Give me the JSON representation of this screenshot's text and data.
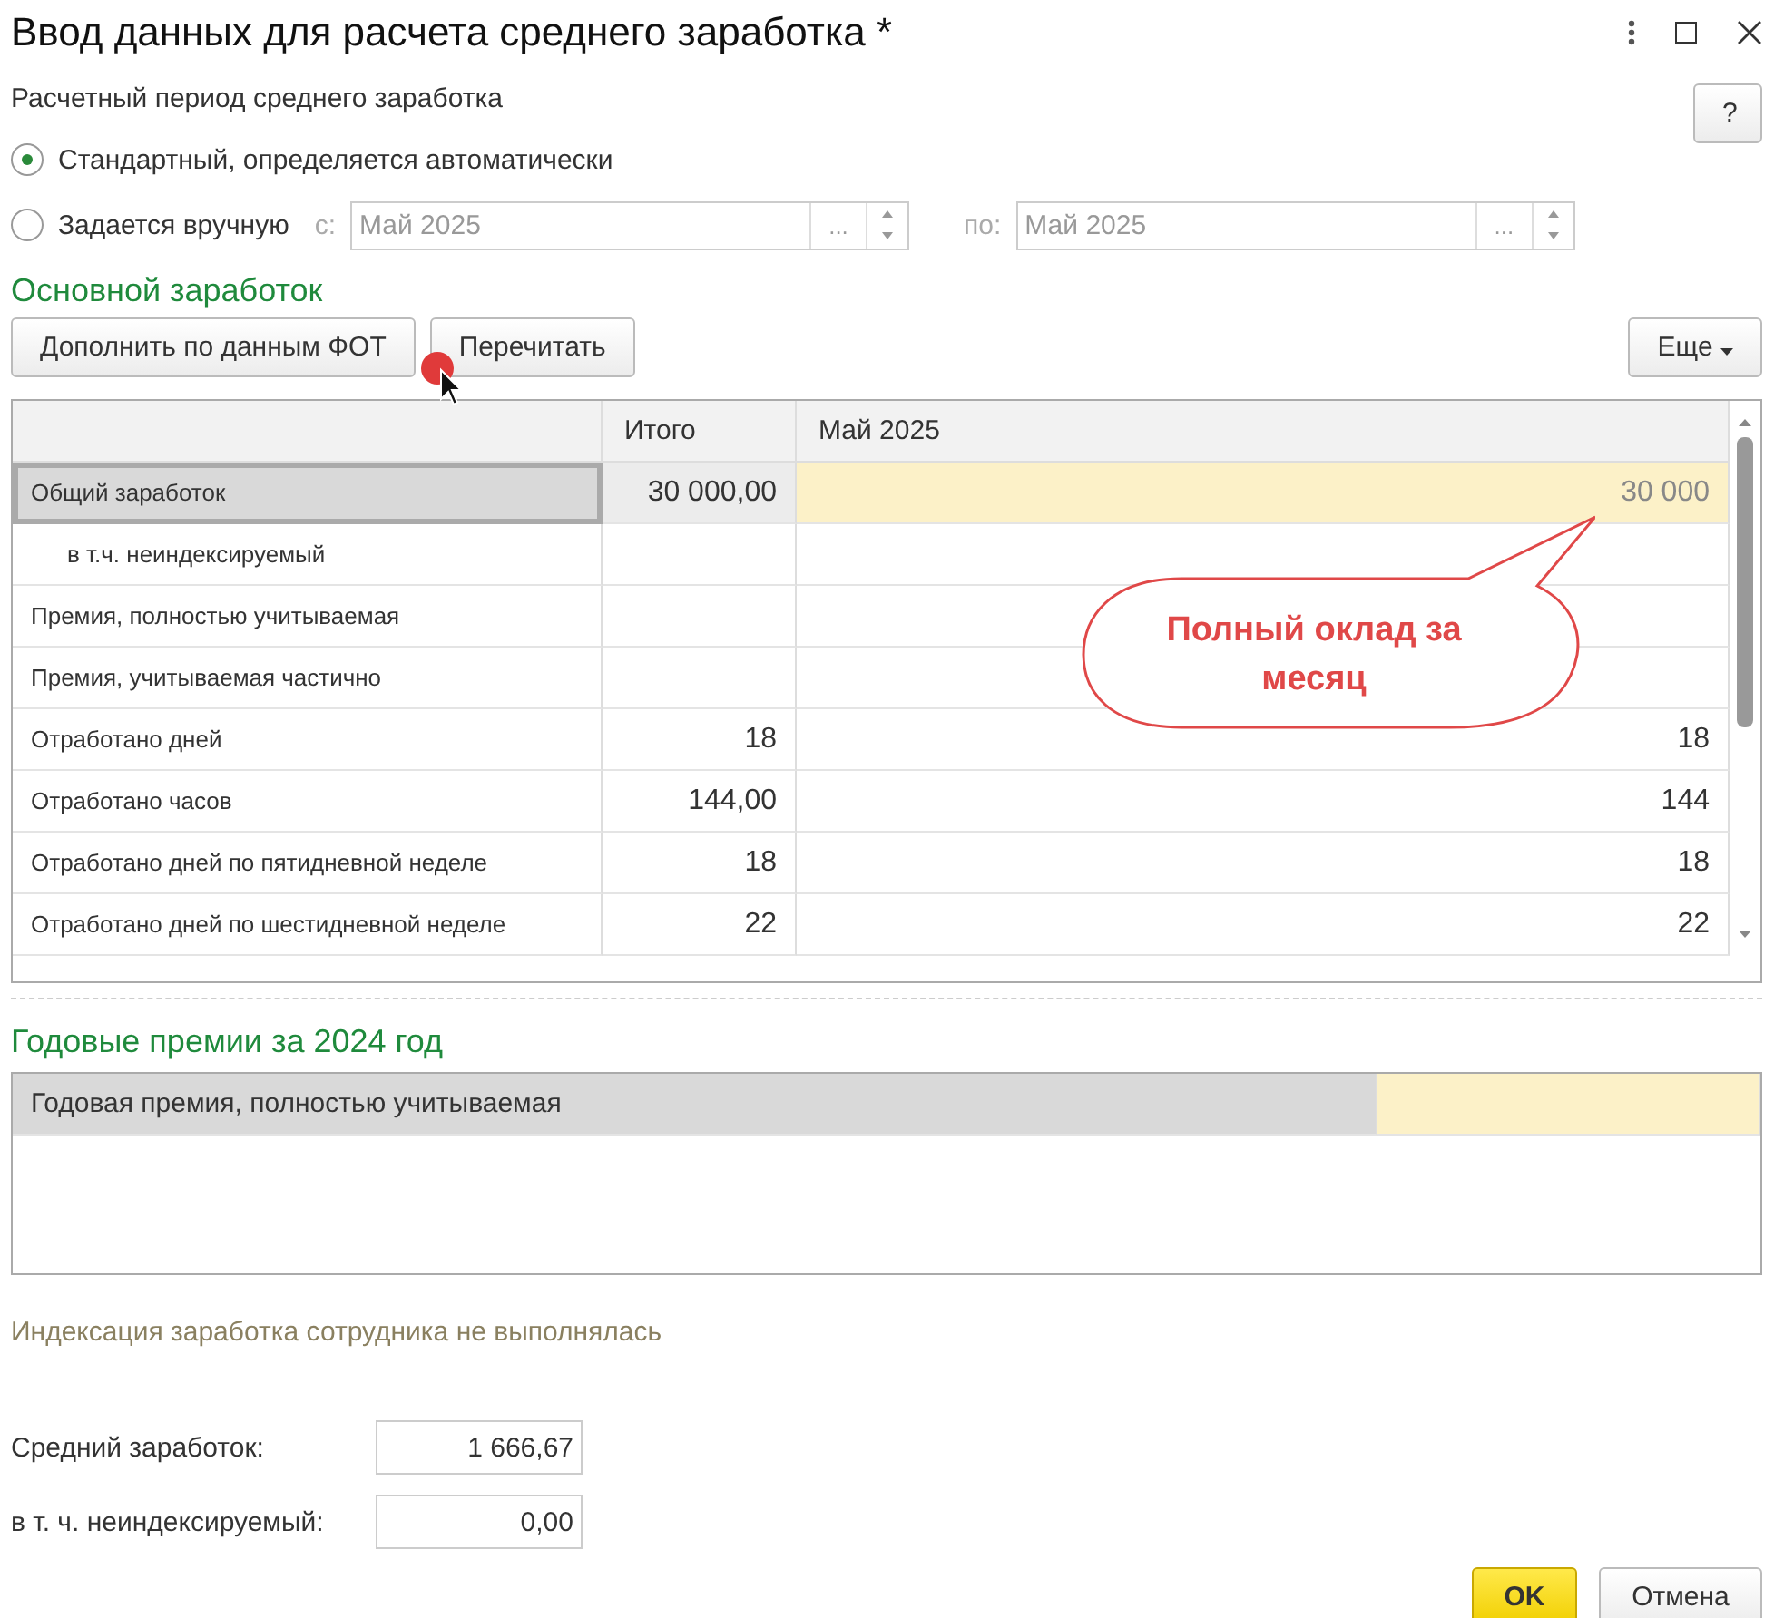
{
  "window": {
    "title": "Ввод данных для расчета среднего заработка *"
  },
  "period": {
    "label": "Расчетный период среднего заработка",
    "help": "?",
    "options": [
      {
        "label": "Стандартный, определяется автоматически",
        "selected": true
      },
      {
        "label": "Задается вручную",
        "selected": false
      }
    ],
    "from": {
      "label": "с:",
      "value": "Май 2025",
      "picker": "...",
      "disabled": true
    },
    "to": {
      "label": "по:",
      "value": "Май 2025",
      "picker": "...",
      "disabled": true
    }
  },
  "main": {
    "title": "Основной заработок",
    "buttons": [
      "Дополнить по данным ФОТ",
      "Перечитать"
    ],
    "more": "Еще",
    "table": {
      "columns": [
        "Итого",
        "Май 2025"
      ],
      "rows": [
        {
          "label": "Общий заработок",
          "total": "30 000,00",
          "month": "30 000",
          "selected": true,
          "children": [
            {
              "label": "в т.ч. неиндексируемый",
              "selected": false
            }
          ]
        },
        {
          "label": "Премия, полностью учитываемая",
          "selected": false
        },
        {
          "label": "Премия, учитываемая частично",
          "selected": false
        },
        {
          "label": "Отработано дней",
          "total": "18",
          "month": "18",
          "selected": false
        },
        {
          "label": "Отработано часов",
          "total": "144,00",
          "month": "144",
          "selected": false
        },
        {
          "label": "Отработано дней по пятидневной неделе",
          "total": "18",
          "month": "18",
          "selected": false
        },
        {
          "label": "Отработано дней по шестидневной неделе",
          "total": "22",
          "month": "22",
          "selected": false
        }
      ]
    },
    "callout": "Полный оклад за месяц"
  },
  "bonuses": {
    "title": "Годовые премии за 2024 год",
    "rows": [
      {
        "label": "Годовая премия, полностью учитываемая",
        "selected": true
      }
    ]
  },
  "indexation_note": "Индексация заработка сотрудника не выполнялась",
  "totals": [
    {
      "label": "Средний заработок:",
      "value": "1 666,67"
    },
    {
      "label": "в т. ч. неиндексируемый:",
      "value": "0,00"
    }
  ],
  "buttons": [
    {
      "label": "OK",
      "kind": "primary"
    },
    {
      "label": "Отмена",
      "kind": "default"
    }
  ]
}
